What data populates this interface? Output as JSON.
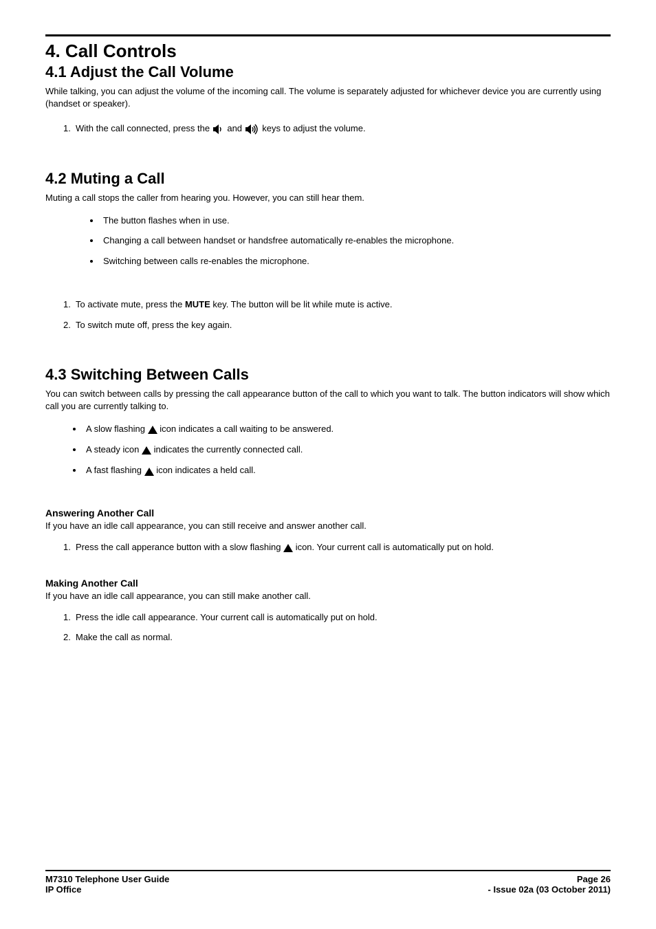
{
  "section": {
    "number": "4.",
    "title": "Call Controls"
  },
  "s41": {
    "heading": "4.1 Adjust the Call Volume",
    "intro": "While talking, you can adjust the volume of the incoming call. The volume is separately adjusted for whichever device you are currently using (handset or speaker).",
    "step1_pre": "With the call connected, press the ",
    "step1_mid": " and ",
    "step1_post": " keys to adjust the volume."
  },
  "s42": {
    "heading": "4.2 Muting a Call",
    "intro": "Muting a call stops the caller from hearing you. However, you can still hear them.",
    "bullets": [
      "The button flashes when in use.",
      "Changing a call between handset or handsfree automatically re-enables the microphone.",
      "Switching between calls re-enables the microphone."
    ],
    "step1_pre": "To activate mute, press the ",
    "step1_key": "MUTE",
    "step1_post": " key. The button will be lit while mute is active.",
    "step2": "To switch mute off, press the key again."
  },
  "s43": {
    "heading": "4.3 Switching Between Calls",
    "intro": "You can switch between calls by pressing the call appearance button of the call to which you want to talk. The button indicators will show which call you are currently talking to.",
    "bullet1_pre": "A slow flashing ",
    "bullet1_post": " icon indicates a call waiting to be answered.",
    "bullet2_pre": "A steady icon ",
    "bullet2_post": " indicates the currently connected call.",
    "bullet3_pre": "A fast flashing ",
    "bullet3_post": " icon indicates a held call.",
    "answering_heading": "Answering Another Call",
    "answering_intro": "If you have an idle call appearance, you can still receive and answer another call.",
    "answering_step1_pre": "Press the call apperance button with a slow flashing ",
    "answering_step1_post": " icon. Your current call is automatically put on hold.",
    "making_heading": "Making Another Call",
    "making_intro": "If you have an idle call appearance, you can still make another call.",
    "making_steps": [
      "Press the idle call appearance. Your current call is automatically put on hold.",
      "Make the call as normal."
    ]
  },
  "footer": {
    "left1": "M7310 Telephone User Guide",
    "right1": "Page 26",
    "left2": "IP Office",
    "right2": "- Issue 02a (03 October 2011)"
  }
}
